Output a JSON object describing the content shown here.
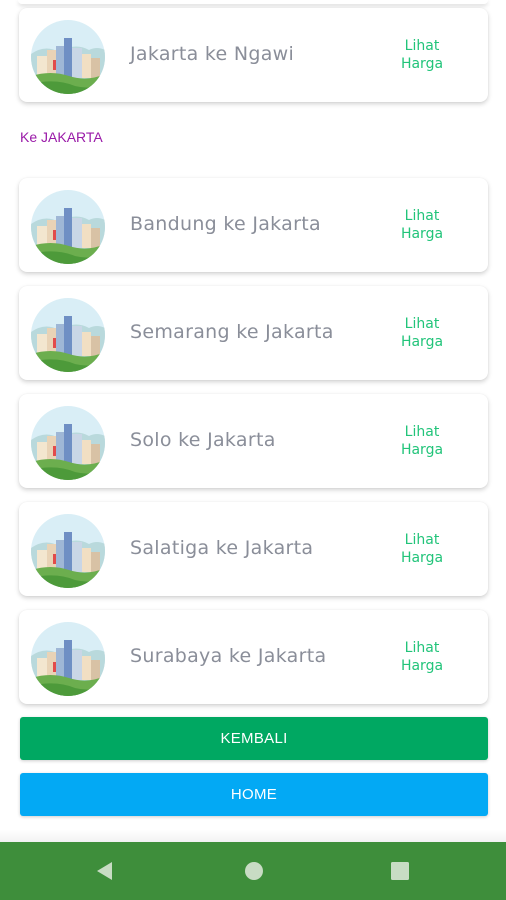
{
  "colors": {
    "route_text": "#8a8e99",
    "link_text": "#22c47a",
    "section_label": "#9a1aa8",
    "back_button": "#00a862",
    "home_button": "#03a9f4",
    "navbar": "#3e8e3b"
  },
  "top_routes": [
    {
      "name": "Jakarta ke Ngawi",
      "link_line1": "Lihat",
      "link_line2": "Harga"
    }
  ],
  "section": {
    "label": "Ke JAKARTA"
  },
  "routes": [
    {
      "name": "Bandung ke Jakarta",
      "link_line1": "Lihat",
      "link_line2": "Harga"
    },
    {
      "name": "Semarang ke Jakarta",
      "link_line1": "Lihat",
      "link_line2": "Harga"
    },
    {
      "name": "Solo ke Jakarta",
      "link_line1": "Lihat",
      "link_line2": "Harga"
    },
    {
      "name": "Salatiga ke Jakarta",
      "link_line1": "Lihat",
      "link_line2": "Harga"
    },
    {
      "name": "Surabaya ke Jakarta",
      "link_line1": "Lihat",
      "link_line2": "Harga"
    }
  ],
  "buttons": {
    "back": "KEMBALI",
    "home": "HOME"
  },
  "navbar": {
    "icons": [
      "back-triangle-icon",
      "home-circle-icon",
      "recent-square-icon"
    ]
  }
}
